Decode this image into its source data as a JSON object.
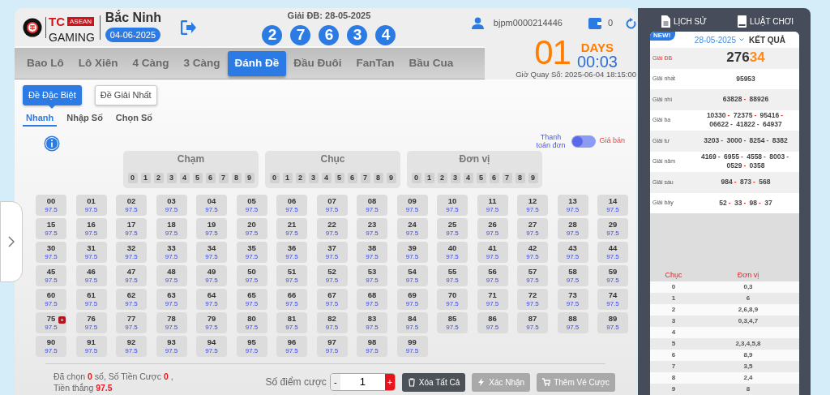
{
  "header": {
    "brand_top": "TC",
    "brand_badge": "ASEAN",
    "brand_bottom": "GAMING",
    "region": "Bắc Ninh",
    "date": "04-06-2025",
    "prize_label": "Giải ĐB: 28-05-2025",
    "prize_digits": [
      "2",
      "7",
      "6",
      "3",
      "4"
    ],
    "username": "bjpm0000214446",
    "balance": "0"
  },
  "tabs": [
    {
      "label": "Bao Lô",
      "selected": false
    },
    {
      "label": "Lô Xiên",
      "selected": false
    },
    {
      "label": "4 Càng",
      "selected": false
    },
    {
      "label": "3 Càng",
      "selected": false
    },
    {
      "label": "Đánh Đề",
      "selected": true
    },
    {
      "label": "Đầu Đuôi",
      "selected": false
    },
    {
      "label": "FanTan",
      "selected": false
    },
    {
      "label": "Bầu Cua",
      "selected": false
    }
  ],
  "countdown": {
    "days": "01",
    "days_label": "DAYS",
    "time": "00:03",
    "draw_time": "Giờ Quay Số: 2025-06-04 18:15:00"
  },
  "prize_types": [
    {
      "label": "Đề Đặc Biệt",
      "selected": true
    },
    {
      "label": "Đề Giải Nhất",
      "selected": false
    }
  ],
  "modes": [
    {
      "label": "Nhanh",
      "selected": true
    },
    {
      "label": "Nhập Số",
      "selected": false
    },
    {
      "label": "Chọn Số",
      "selected": false
    }
  ],
  "payment_toggle": {
    "left_label": "Thanh toán đơn",
    "right_label": "Giá bán",
    "on": false
  },
  "digit_groups": [
    {
      "title": "Chạm",
      "digits": [
        "0",
        "1",
        "2",
        "3",
        "4",
        "5",
        "6",
        "7",
        "8",
        "9"
      ]
    },
    {
      "title": "Chục",
      "digits": [
        "0",
        "1",
        "2",
        "3",
        "4",
        "5",
        "6",
        "7",
        "8",
        "9"
      ]
    },
    {
      "title": "Đơn vị",
      "digits": [
        "0",
        "1",
        "2",
        "3",
        "4",
        "5",
        "6",
        "7",
        "8",
        "9"
      ]
    }
  ],
  "numbers": [
    {
      "number": "00",
      "odds": "97.5",
      "marked": false
    },
    {
      "number": "01",
      "odds": "97.5",
      "marked": false
    },
    {
      "number": "02",
      "odds": "97.5",
      "marked": false
    },
    {
      "number": "03",
      "odds": "97.5",
      "marked": false
    },
    {
      "number": "04",
      "odds": "97.5",
      "marked": false
    },
    {
      "number": "05",
      "odds": "97.5",
      "marked": false
    },
    {
      "number": "06",
      "odds": "97.5",
      "marked": false
    },
    {
      "number": "07",
      "odds": "97.5",
      "marked": false
    },
    {
      "number": "08",
      "odds": "97.5",
      "marked": false
    },
    {
      "number": "09",
      "odds": "97.5",
      "marked": false
    },
    {
      "number": "10",
      "odds": "97.5",
      "marked": false
    },
    {
      "number": "11",
      "odds": "97.5",
      "marked": false
    },
    {
      "number": "12",
      "odds": "97.5",
      "marked": false
    },
    {
      "number": "13",
      "odds": "97.5",
      "marked": false
    },
    {
      "number": "14",
      "odds": "97.5",
      "marked": false
    },
    {
      "number": "15",
      "odds": "97.5",
      "marked": false
    },
    {
      "number": "16",
      "odds": "97.5",
      "marked": false
    },
    {
      "number": "17",
      "odds": "97.5",
      "marked": false
    },
    {
      "number": "18",
      "odds": "97.5",
      "marked": false
    },
    {
      "number": "19",
      "odds": "97.5",
      "marked": false
    },
    {
      "number": "20",
      "odds": "97.5",
      "marked": false
    },
    {
      "number": "21",
      "odds": "97.5",
      "marked": false
    },
    {
      "number": "22",
      "odds": "97.5",
      "marked": false
    },
    {
      "number": "23",
      "odds": "97.5",
      "marked": false
    },
    {
      "number": "24",
      "odds": "97.5",
      "marked": false
    },
    {
      "number": "25",
      "odds": "97.5",
      "marked": false
    },
    {
      "number": "26",
      "odds": "97.5",
      "marked": false
    },
    {
      "number": "27",
      "odds": "97.5",
      "marked": false
    },
    {
      "number": "28",
      "odds": "97.5",
      "marked": false
    },
    {
      "number": "29",
      "odds": "97.5",
      "marked": false
    },
    {
      "number": "30",
      "odds": "97.5",
      "marked": false
    },
    {
      "number": "31",
      "odds": "97.5",
      "marked": false
    },
    {
      "number": "32",
      "odds": "97.5",
      "marked": false
    },
    {
      "number": "33",
      "odds": "97.5",
      "marked": false
    },
    {
      "number": "34",
      "odds": "97.5",
      "marked": false
    },
    {
      "number": "35",
      "odds": "97.5",
      "marked": false
    },
    {
      "number": "36",
      "odds": "97.5",
      "marked": false
    },
    {
      "number": "37",
      "odds": "97.5",
      "marked": false
    },
    {
      "number": "38",
      "odds": "97.5",
      "marked": false
    },
    {
      "number": "39",
      "odds": "97.5",
      "marked": false
    },
    {
      "number": "40",
      "odds": "97.5",
      "marked": false
    },
    {
      "number": "41",
      "odds": "97.5",
      "marked": false
    },
    {
      "number": "42",
      "odds": "97.5",
      "marked": false
    },
    {
      "number": "43",
      "odds": "97.5",
      "marked": false
    },
    {
      "number": "44",
      "odds": "97.5",
      "marked": false
    },
    {
      "number": "45",
      "odds": "97.5",
      "marked": false
    },
    {
      "number": "46",
      "odds": "97.5",
      "marked": false
    },
    {
      "number": "47",
      "odds": "97.5",
      "marked": false
    },
    {
      "number": "48",
      "odds": "97.5",
      "marked": false
    },
    {
      "number": "49",
      "odds": "97.5",
      "marked": false
    },
    {
      "number": "50",
      "odds": "97.5",
      "marked": false
    },
    {
      "number": "51",
      "odds": "97.5",
      "marked": false
    },
    {
      "number": "52",
      "odds": "97.5",
      "marked": false
    },
    {
      "number": "53",
      "odds": "97.5",
      "marked": false
    },
    {
      "number": "54",
      "odds": "97.5",
      "marked": false
    },
    {
      "number": "55",
      "odds": "97.5",
      "marked": false
    },
    {
      "number": "56",
      "odds": "97.5",
      "marked": false
    },
    {
      "number": "57",
      "odds": "97.5",
      "marked": false
    },
    {
      "number": "58",
      "odds": "97.5",
      "marked": false
    },
    {
      "number": "59",
      "odds": "97.5",
      "marked": false
    },
    {
      "number": "60",
      "odds": "97.5",
      "marked": false
    },
    {
      "number": "61",
      "odds": "97.5",
      "marked": false
    },
    {
      "number": "62",
      "odds": "97.5",
      "marked": false
    },
    {
      "number": "63",
      "odds": "97.5",
      "marked": false
    },
    {
      "number": "64",
      "odds": "97.5",
      "marked": false
    },
    {
      "number": "65",
      "odds": "97.5",
      "marked": false
    },
    {
      "number": "66",
      "odds": "97.5",
      "marked": false
    },
    {
      "number": "67",
      "odds": "97.5",
      "marked": false
    },
    {
      "number": "68",
      "odds": "97.5",
      "marked": false
    },
    {
      "number": "69",
      "odds": "97.5",
      "marked": false
    },
    {
      "number": "70",
      "odds": "97.5",
      "marked": false
    },
    {
      "number": "71",
      "odds": "97.5",
      "marked": false
    },
    {
      "number": "72",
      "odds": "97.5",
      "marked": false
    },
    {
      "number": "73",
      "odds": "97.5",
      "marked": false
    },
    {
      "number": "74",
      "odds": "97.5",
      "marked": false
    },
    {
      "number": "75",
      "odds": "97.5",
      "marked": true
    },
    {
      "number": "76",
      "odds": "97.5",
      "marked": false
    },
    {
      "number": "77",
      "odds": "97.5",
      "marked": false
    },
    {
      "number": "78",
      "odds": "97.5",
      "marked": false
    },
    {
      "number": "79",
      "odds": "97.5",
      "marked": false
    },
    {
      "number": "80",
      "odds": "97.5",
      "marked": false
    },
    {
      "number": "81",
      "odds": "97.5",
      "marked": false
    },
    {
      "number": "82",
      "odds": "97.5",
      "marked": false
    },
    {
      "number": "83",
      "odds": "97.5",
      "marked": false
    },
    {
      "number": "84",
      "odds": "97.5",
      "marked": false
    },
    {
      "number": "85",
      "odds": "97.5",
      "marked": false
    },
    {
      "number": "86",
      "odds": "97.5",
      "marked": false
    },
    {
      "number": "87",
      "odds": "97.5",
      "marked": false
    },
    {
      "number": "88",
      "odds": "97.5",
      "marked": false
    },
    {
      "number": "89",
      "odds": "97.5",
      "marked": false
    },
    {
      "number": "90",
      "odds": "97.5",
      "marked": false
    },
    {
      "number": "91",
      "odds": "97.5",
      "marked": false
    },
    {
      "number": "92",
      "odds": "97.5",
      "marked": false
    },
    {
      "number": "93",
      "odds": "97.5",
      "marked": false
    },
    {
      "number": "94",
      "odds": "97.5",
      "marked": false
    },
    {
      "number": "95",
      "odds": "97.5",
      "marked": false
    },
    {
      "number": "96",
      "odds": "97.5",
      "marked": false
    },
    {
      "number": "97",
      "odds": "97.5",
      "marked": false
    },
    {
      "number": "98",
      "odds": "97.5",
      "marked": false
    },
    {
      "number": "99",
      "odds": "97.5",
      "marked": false
    }
  ],
  "summary": "Đã chọn **0** số,  Số Tiền Cược **0** , Tiền thắng **97.5**",
  "bet": {
    "label": "Số điểm cược",
    "minus": "-",
    "value": "1",
    "plus": "+"
  },
  "actions": [
    {
      "kind": "clear",
      "label": "Xóa Tất Cả",
      "disabled": false
    },
    {
      "kind": "confirm",
      "label": "Xác Nhận",
      "disabled": true
    },
    {
      "kind": "cart",
      "label": "Thêm Vé Cược",
      "disabled": true
    }
  ],
  "side": {
    "links": [
      {
        "kind": "history",
        "label": "LỊCH SỬ"
      },
      {
        "kind": "rules",
        "label": "LUẬT CHƠI"
      }
    ],
    "badge": "NEW!",
    "date": "28-05-2025",
    "title": "KẾT QUẢ",
    "separator": "-",
    "special": {
      "label": "Giải ĐB",
      "head": "276",
      "tail": "34"
    },
    "prizes": [
      {
        "label": "Giải nhất",
        "numbers": [
          "95953"
        ]
      },
      {
        "label": "Giải nhì",
        "numbers": [
          "63828",
          "88926"
        ]
      },
      {
        "label": "Giải ba",
        "numbers": [
          "10330",
          "72375",
          "95416",
          "06622",
          "41822",
          "64937"
        ]
      },
      {
        "label": "Giải tư",
        "numbers": [
          "3203",
          "3000",
          "8254",
          "8382"
        ]
      },
      {
        "label": "Giải năm",
        "numbers": [
          "4169",
          "6955",
          "4558",
          "8003",
          "0529",
          "0358"
        ]
      },
      {
        "label": "Giải sáu",
        "numbers": [
          "984",
          "873",
          "568"
        ]
      },
      {
        "label": "Giải bảy",
        "numbers": [
          "52",
          "33",
          "98",
          "37"
        ]
      }
    ],
    "stats_headers": [
      "Chục",
      "Đơn vị"
    ],
    "stats": [
      {
        "tens": "0",
        "units": "0,3"
      },
      {
        "tens": "1",
        "units": "6"
      },
      {
        "tens": "2",
        "units": "2,6,8,9"
      },
      {
        "tens": "3",
        "units": "0,3,4,7"
      },
      {
        "tens": "4"
      },
      {
        "tens": "5",
        "units": "2,3,4,5,8"
      },
      {
        "tens": "6",
        "units": "8,9"
      },
      {
        "tens": "7",
        "units": "3,5"
      },
      {
        "tens": "8",
        "units": "2,4"
      },
      {
        "tens": "9",
        "units": "8"
      }
    ]
  }
}
